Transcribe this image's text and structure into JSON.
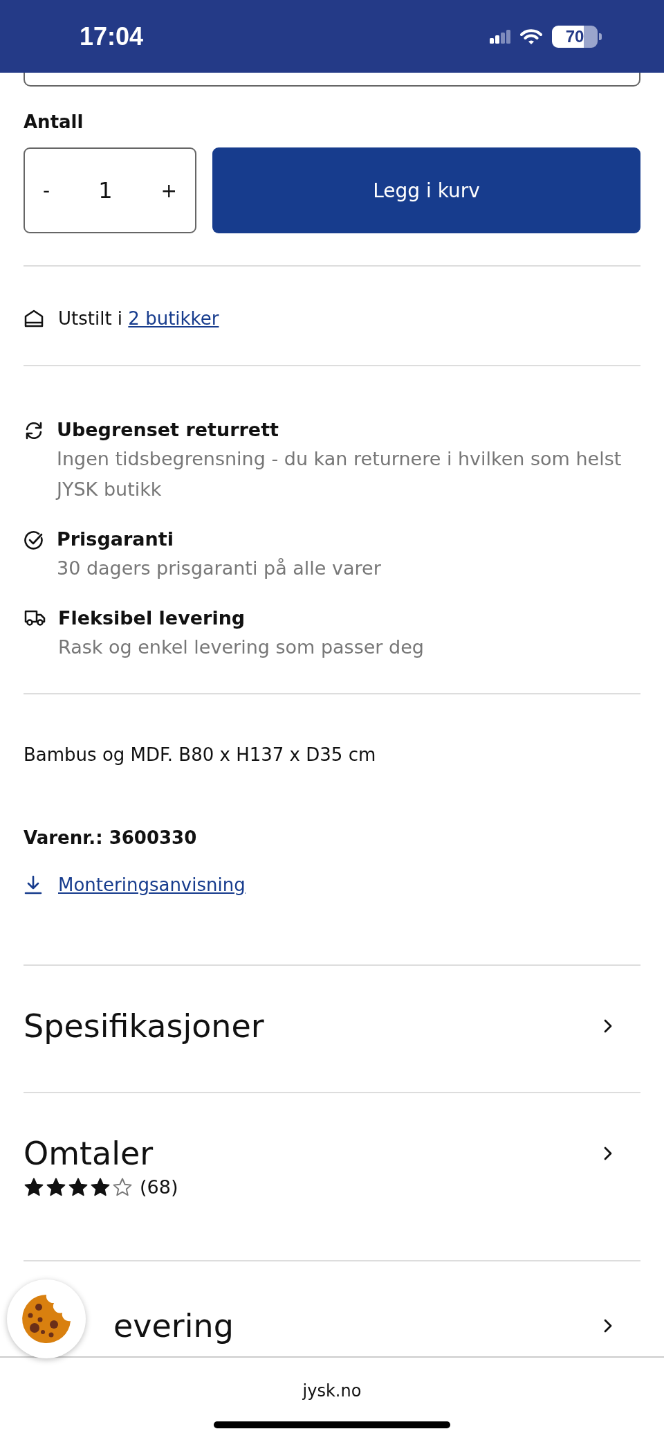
{
  "status_bar": {
    "time": "17:04",
    "battery": "70"
  },
  "quantity": {
    "label": "Antall",
    "minus": "-",
    "value": "1",
    "plus": "+"
  },
  "add_to_cart": "Legg i kurv",
  "store": {
    "text": "Utstilt i ",
    "link": "2 butikker"
  },
  "features": [
    {
      "kind": "return",
      "title": "Ubegrenset returrett",
      "text": "Ingen tidsbegrensning - du kan returnere i hvilken som helst JYSK butikk"
    },
    {
      "kind": "price",
      "title": "Prisgaranti",
      "text": "30 dagers prisgaranti på alle varer"
    },
    {
      "kind": "delivery",
      "title": "Fleksibel levering",
      "text": "Rask og enkel levering som passer deg"
    }
  ],
  "description": "Bambus og MDF. B80 x H137 x D35 cm",
  "item_number": "Varenr.: 3600330",
  "download_link": "Monteringsanvisning",
  "sections": [
    {
      "title": "Spesifikasjoner"
    },
    {
      "title": "Omtaler",
      "stars": 4,
      "count": "(68)"
    },
    {
      "title": "evering"
    }
  ],
  "url": "jysk.no"
}
